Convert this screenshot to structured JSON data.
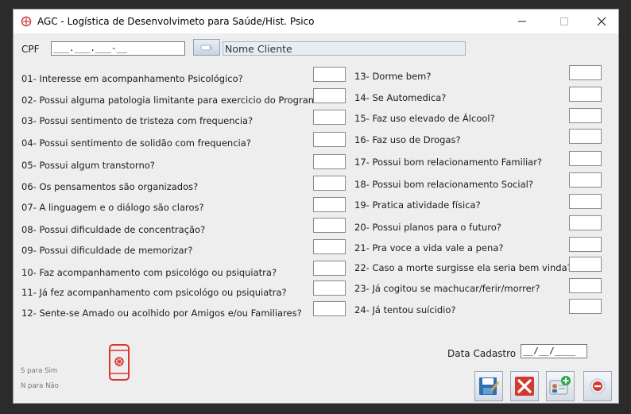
{
  "window": {
    "title": "AGC - Logística de Desenvolvimeto para Saúde/Hist. Psico"
  },
  "cpf": {
    "label": "CPF",
    "value": "___.___.___-__"
  },
  "nome_cliente": "Nome Cliente",
  "questions_left": [
    {
      "text": "01- Interesse em acompanhamento Psicológico?",
      "value": ""
    },
    {
      "text": "02- Possui alguma patologia limitante para exercicio do Programa?",
      "value": ""
    },
    {
      "text": "03- Possui sentimento de tristeza com frequencia?",
      "value": ""
    },
    {
      "text": "04- Possui sentimento de solidão com frequencia?",
      "value": ""
    },
    {
      "text": "05- Possui algum transtorno?",
      "value": ""
    },
    {
      "text": "06- Os pensamentos são organizados?",
      "value": ""
    },
    {
      "text": "07- A linguagem e o diálogo são claros?",
      "value": ""
    },
    {
      "text": "08- Possui dificuldade de concentração?",
      "value": ""
    },
    {
      "text": "09- Possui dificuldade de memorizar?",
      "value": ""
    },
    {
      "text": "10- Faz acompanhamento com psicológo ou psiquiatra?",
      "value": ""
    },
    {
      "text": "11- Já fez acompanhamento com psicológo ou psiquiatra?",
      "value": ""
    },
    {
      "text": "12- Sente-se Amado ou acolhido por Amigos e/ou Familiares?",
      "value": ""
    }
  ],
  "questions_right": [
    {
      "text": "13- Dorme bem?",
      "value": ""
    },
    {
      "text": "14- Se Automedica?",
      "value": ""
    },
    {
      "text": "15- Faz uso elevado de Álcool?",
      "value": ""
    },
    {
      "text": "16- Faz uso de Drogas?",
      "value": ""
    },
    {
      "text": "17- Possui bom relacionamento Familiar?",
      "value": ""
    },
    {
      "text": "18- Possui bom relacionamento Social?",
      "value": ""
    },
    {
      "text": "19- Pratica atividade física?",
      "value": ""
    },
    {
      "text": "20- Possui planos para o futuro?",
      "value": ""
    },
    {
      "text": "21- Pra voce a vida vale a pena?",
      "value": ""
    },
    {
      "text": "22- Caso a morte surgisse ela seria bem vinda?",
      "value": ""
    },
    {
      "text": "23- Já cogitou se machucar/ferir/morrer?",
      "value": ""
    },
    {
      "text": "24- Já tentou suícidio?",
      "value": ""
    }
  ],
  "legend": {
    "sim": "S para Sim",
    "nao": "N para Não"
  },
  "data_cadastro": {
    "label": "Data Cadastro",
    "value": "__/__/____"
  },
  "icons": {
    "save": "save-icon",
    "cancel": "cancel-icon",
    "add_user": "add-user-icon",
    "exit": "exit-icon",
    "search": "search-icon",
    "phone": "phone-icon"
  },
  "colors": {
    "accent_red": "#d9362f",
    "field_border": "#8a8a8a",
    "background": "#eeeeee"
  }
}
